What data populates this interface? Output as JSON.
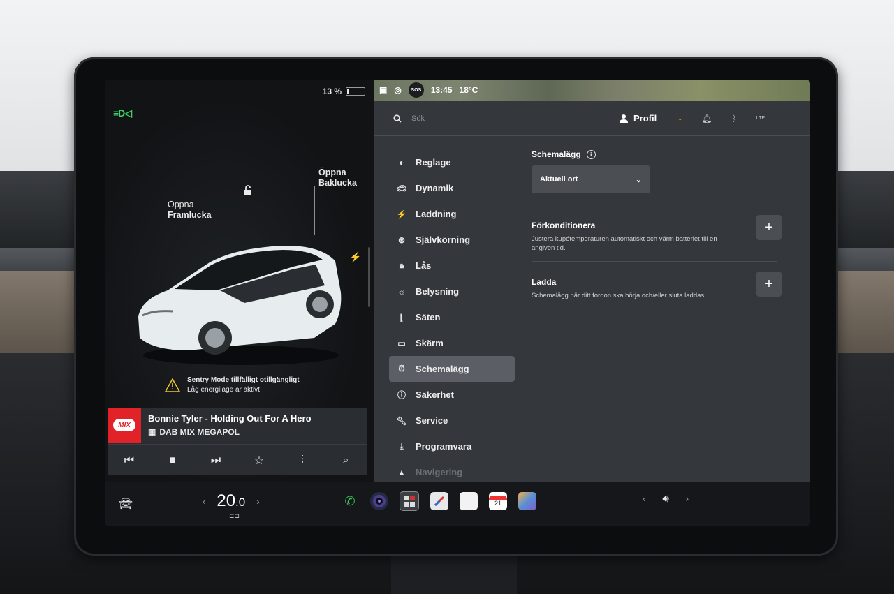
{
  "status": {
    "battery_percent": "13 %",
    "battery_level": 0.13,
    "time": "13:45",
    "temperature": "18°C",
    "sos": "SOS"
  },
  "car_view": {
    "frunk_line1": "Öppna",
    "frunk_line2": "Framlucka",
    "trunk_line1": "Öppna",
    "trunk_line2": "Baklucka",
    "sentry_title": "Sentry Mode tillfälligt otillgängligt",
    "sentry_sub": "Låg energiläge är aktivt"
  },
  "media": {
    "logo_text": "MIX",
    "track": "Bonnie Tyler - Holding Out For A Hero",
    "station": "DAB MIX MEGAPOL"
  },
  "topbar": {
    "search_placeholder": "Sök",
    "profile_label": "Profil",
    "lte": "LTE"
  },
  "menu": {
    "items": [
      {
        "label": "Reglage",
        "icon": "toggle-icon"
      },
      {
        "label": "Dynamik",
        "icon": "car-icon"
      },
      {
        "label": "Laddning",
        "icon": "bolt-icon"
      },
      {
        "label": "Självkörning",
        "icon": "steering-wheel-icon"
      },
      {
        "label": "Lås",
        "icon": "lock-icon"
      },
      {
        "label": "Belysning",
        "icon": "sun-icon"
      },
      {
        "label": "Säten",
        "icon": "seat-icon"
      },
      {
        "label": "Skärm",
        "icon": "screen-icon"
      },
      {
        "label": "Schemalägg",
        "icon": "alarm-clock-icon",
        "active": true
      },
      {
        "label": "Säkerhet",
        "icon": "info-circle-icon"
      },
      {
        "label": "Service",
        "icon": "wrench-icon"
      },
      {
        "label": "Programvara",
        "icon": "download-icon"
      },
      {
        "label": "Navigering",
        "icon": "navigation-arrow-icon"
      }
    ]
  },
  "schedule": {
    "title": "Schemalägg",
    "location_value": "Aktuell ort",
    "precondition_title": "Förkonditionera",
    "precondition_desc": "Justera kupétemperaturen automatiskt och värm batteriet till en angiven tid.",
    "charge_title": "Ladda",
    "charge_desc": "Schemalägg när ditt fordon ska börja och/eller sluta laddas."
  },
  "dock": {
    "temp_whole": "20",
    "temp_decimal": ".0",
    "calendar_day": "21"
  },
  "colors": {
    "accent_green": "#3fd16a",
    "download_orange": "#f0a020",
    "mix_red": "#e22229",
    "phone_green": "#3cc95b"
  }
}
